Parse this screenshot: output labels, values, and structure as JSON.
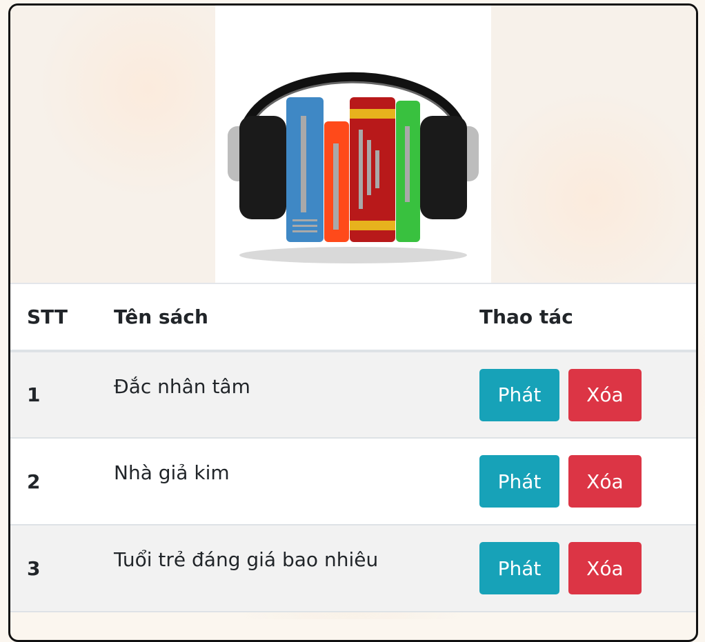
{
  "logo": {
    "icon": "headphones-books-icon"
  },
  "table": {
    "headers": {
      "stt": "STT",
      "name": "Tên sách",
      "actions": "Thao tác"
    },
    "rows": [
      {
        "stt": "1",
        "name": "Đắc nhân tâm",
        "play": "Phát",
        "delete": "Xóa"
      },
      {
        "stt": "2",
        "name": "Nhà giả kim",
        "play": "Phát",
        "delete": "Xóa"
      },
      {
        "stt": "3",
        "name": "Tuổi trẻ đáng giá bao nhiêu",
        "play": "Phát",
        "delete": "Xóa"
      }
    ]
  },
  "colors": {
    "play": "#17a2b8",
    "delete": "#dc3545",
    "stripe": "#f2f2f2"
  }
}
